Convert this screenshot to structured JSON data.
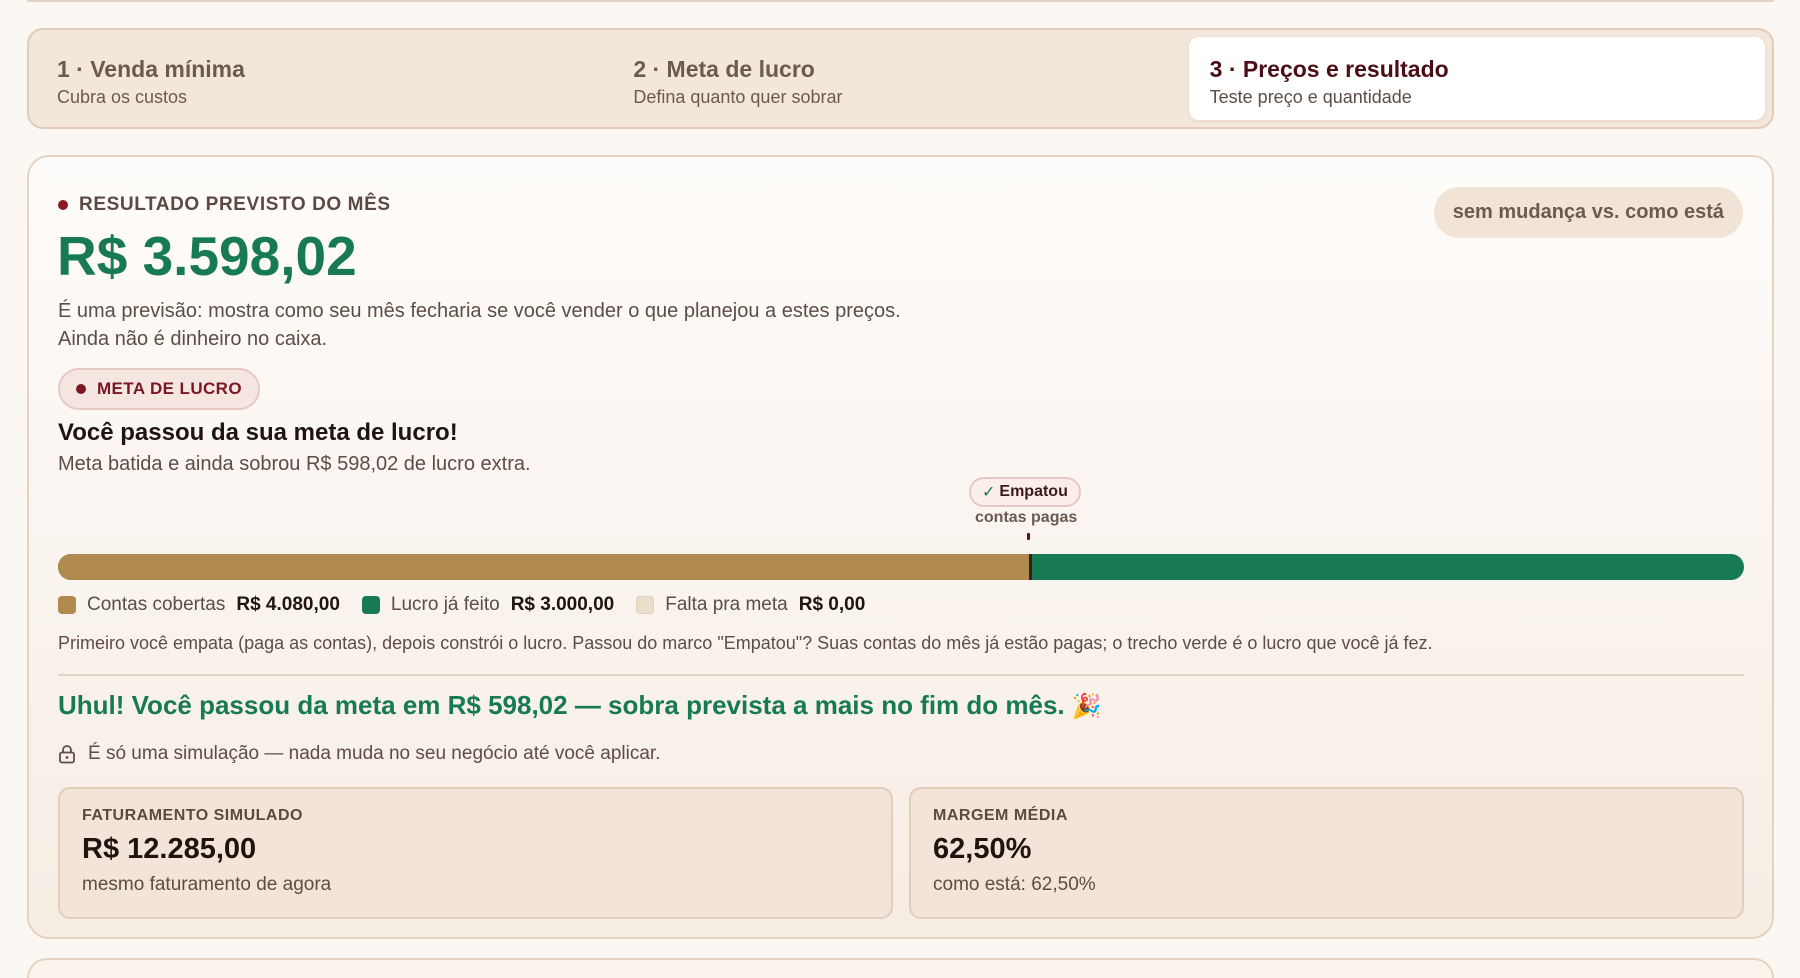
{
  "steps": [
    {
      "title": "1 · Venda mínima",
      "subtitle": "Cubra os custos",
      "active": false
    },
    {
      "title": "2 · Meta de lucro",
      "subtitle": "Defina quanto quer sobrar",
      "active": false
    },
    {
      "title": "3 · Preços e resultado",
      "subtitle": "Teste preço e quantidade",
      "active": true
    }
  ],
  "result": {
    "kicker": "RESULTADO PREVISTO DO MÊS",
    "value": "R$ 3.598,02",
    "change_label": "sem mudança vs. como está",
    "description": "É uma previsão: mostra como seu mês fecharia se você vender o que planejou a estes preços. Ainda não é dinheiro no caixa."
  },
  "goal": {
    "pill_label": "META DE LUCRO",
    "headline": "Você passou da sua meta de lucro!",
    "subline": "Meta batida e ainda sobrou R$ 598,02 de lucro extra."
  },
  "progress": {
    "tie_badge": "Empatou",
    "tie_caption": "contas pagas",
    "covered_fraction": 0.5766,
    "legend": [
      {
        "label": "Contas cobertas",
        "value": "R$ 4.080,00",
        "color": "#b08a4e"
      },
      {
        "label": "Lucro já feito",
        "value": "R$ 3.000,00",
        "color": "#187a52"
      },
      {
        "label": "Falta pra meta",
        "value": "R$ 0,00",
        "color": "#eaddc9"
      }
    ],
    "explanation": "Primeiro você empata (paga as contas), depois constrói o lucro. Passou do marco \"Empatou\"? Suas contas do mês já estão pagas; o trecho verde é o lucro que você já fez."
  },
  "celebration": {
    "text": "Uhul! Você passou da meta em R$ 598,02 — sobra prevista a mais no fim do mês.",
    "emoji": "🎉"
  },
  "simulation_note": "É só uma simulação — nada muda no seu negócio até você aplicar.",
  "stats": [
    {
      "label": "FATURAMENTO SIMULADO",
      "value": "R$ 12.285,00",
      "note": "mesmo faturamento de agora"
    },
    {
      "label": "MARGEM MÉDIA",
      "value": "62,50%",
      "note": "como está: 62,50%"
    }
  ],
  "colors": {
    "accent_green": "#187a52",
    "covered_gold": "#b08a4e",
    "brand_wine": "#7a1722"
  }
}
